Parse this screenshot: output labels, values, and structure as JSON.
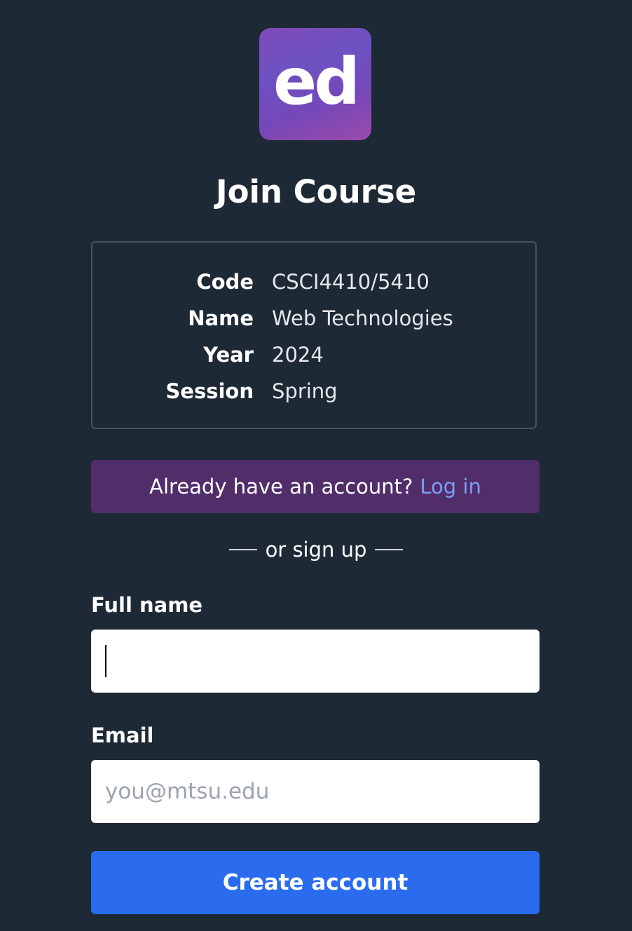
{
  "logo": {
    "text": "ed"
  },
  "page_title": "Join Course",
  "course_info": [
    {
      "label": "Code",
      "value": "CSCI4410/5410"
    },
    {
      "label": "Name",
      "value": "Web Technologies"
    },
    {
      "label": "Year",
      "value": "2024"
    },
    {
      "label": "Session",
      "value": "Spring"
    }
  ],
  "login_banner": {
    "prompt": "Already have an account?",
    "link_label": "Log in"
  },
  "divider_text": "or sign up",
  "form": {
    "full_name": {
      "label": "Full name",
      "value": "",
      "placeholder": ""
    },
    "email": {
      "label": "Email",
      "value": "",
      "placeholder": "you@mtsu.edu"
    },
    "submit_label": "Create account"
  },
  "colors": {
    "background": "#1e2936",
    "banner": "#512d6a",
    "link": "#7b9ff2",
    "primary_button": "#2a6ced"
  }
}
